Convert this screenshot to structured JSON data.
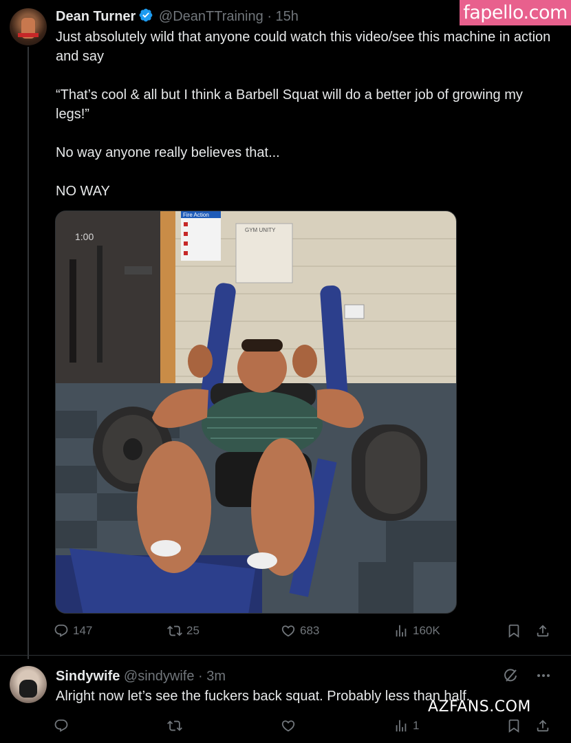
{
  "watermarks": {
    "top": "fapello.com",
    "bottom": "AZFANS.COM"
  },
  "post": {
    "author_name": "Dean Turner",
    "handle": "@DeanTTraining",
    "separator": "·",
    "time": "15h",
    "paragraphs": [
      "Just absolutely wild that anyone could watch this video/see this machine in action and say",
      "“That’s cool & all but I think a Barbell Squat will do a better job of growing my legs!”",
      "No way anyone really believes that...",
      "NO WAY"
    ],
    "video": {
      "timestamp": "1:00",
      "sign_title": "Fire Action",
      "notice_title": "GYM UNITY"
    },
    "stats": {
      "replies": "147",
      "reposts": "25",
      "likes": "683",
      "views": "160K"
    }
  },
  "reply": {
    "author_name": "Sindywife",
    "handle": "@sindywife",
    "separator": "·",
    "time": "3m",
    "text": "Alright now let’s see the fuckers back squat.  Probably less than half.",
    "stats": {
      "views": "1"
    }
  },
  "colors": {
    "background": "#000000",
    "text": "#e7e9ea",
    "muted": "#71767b",
    "verified": "#1d9bf0",
    "watermark": "#e8608d"
  },
  "icons": [
    "verified-badge-icon",
    "reply-icon",
    "repost-icon",
    "like-icon",
    "views-icon",
    "bookmark-icon",
    "share-icon",
    "grok-icon",
    "more-icon"
  ]
}
